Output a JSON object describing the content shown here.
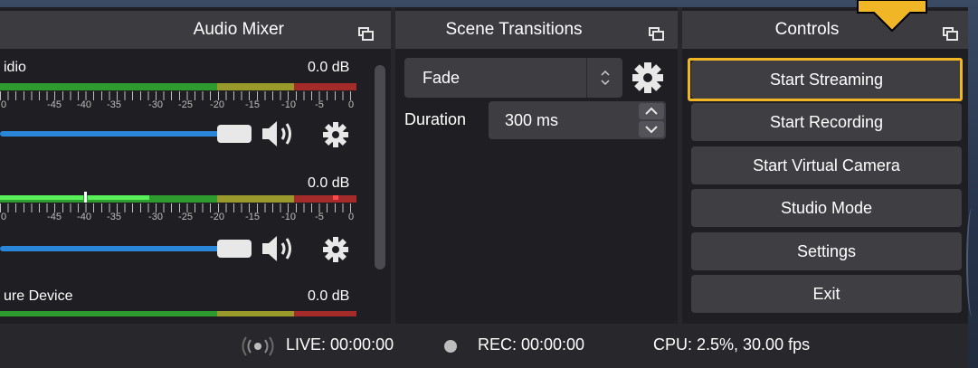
{
  "docks": {
    "audio_mixer": {
      "title": "Audio Mixer"
    },
    "scene_transitions": {
      "title": "Scene Transitions"
    },
    "controls": {
      "title": "Controls"
    }
  },
  "mixer": {
    "channels": [
      {
        "name": "idio",
        "level": "0.0 dB",
        "ticks": [
          "0",
          "-45",
          "-40",
          "-35",
          "-30",
          "-25",
          "-20",
          "-15",
          "-10",
          "-5",
          "0"
        ]
      },
      {
        "name": "",
        "level": "0.0 dB",
        "ticks": [
          "0",
          "-45",
          "-40",
          "-35",
          "-30",
          "-25",
          "-20",
          "-15",
          "-10",
          "-5",
          "0"
        ]
      },
      {
        "name": "ure Device",
        "level": "0.0 dB"
      }
    ]
  },
  "transitions": {
    "selected": "Fade",
    "duration_label": "Duration",
    "duration_value": "300 ms"
  },
  "controls": {
    "buttons": [
      "Start Streaming",
      "Start Recording",
      "Start Virtual Camera",
      "Studio Mode",
      "Settings",
      "Exit"
    ],
    "highlighted": "Start Streaming"
  },
  "status": {
    "live": "LIVE: 00:00:00",
    "rec": "REC: 00:00:00",
    "cpu": "CPU: 2.5%, 30.00 fps"
  },
  "colors": {
    "highlight": "#f1b625",
    "meter_green": "#2e9b2e",
    "meter_yellow": "#9a9a2c",
    "meter_red": "#a52a2a",
    "slider_blue": "#2a86d8"
  }
}
